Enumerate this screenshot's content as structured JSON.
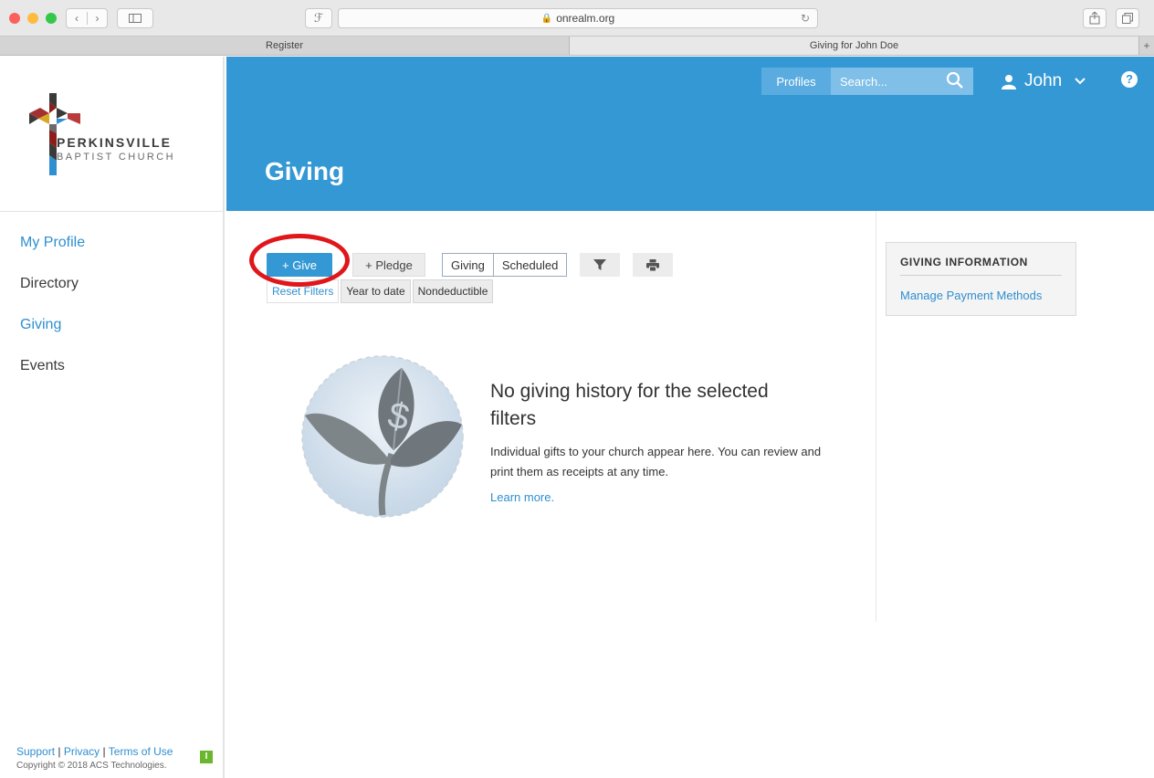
{
  "browser": {
    "url": "onrealm.org",
    "tabs": [
      {
        "label": "Register",
        "active": false
      },
      {
        "label": "Giving for John Doe",
        "active": true
      }
    ],
    "new_tab": "+"
  },
  "org": {
    "name_line1": "PERKINSVILLE",
    "name_line2": "BAPTIST CHURCH"
  },
  "sidebar": {
    "items": [
      {
        "label": "My Profile",
        "style": "link"
      },
      {
        "label": "Directory",
        "style": "plain"
      },
      {
        "label": "Giving",
        "style": "link"
      },
      {
        "label": "Events",
        "style": "plain"
      }
    ],
    "footer": {
      "support": "Support",
      "privacy": "Privacy",
      "terms": "Terms of Use",
      "separator": "|",
      "copyright": "Copyright © 2018 ACS Technologies.",
      "badge": "I"
    }
  },
  "header": {
    "profiles_label": "Profiles",
    "search_placeholder": "Search...",
    "user_name": "John",
    "help": "?",
    "page_title": "Giving"
  },
  "toolbar": {
    "give_label": "+ Give",
    "pledge_label": "+ Pledge",
    "view_tabs": [
      "Giving",
      "Scheduled"
    ],
    "filter_chips": [
      "Reset Filters",
      "Year to date",
      "Nondeductible"
    ]
  },
  "empty_state": {
    "title": "No giving history for the selected filters",
    "description": "Individual gifts to your church appear here. You can review and print them as receipts at any time.",
    "link": "Learn more."
  },
  "info_panel": {
    "title": "GIVING INFORMATION",
    "link": "Manage Payment Methods"
  },
  "colors": {
    "primary": "#3498d4",
    "link": "#2f8fd0",
    "highlight": "#e0161b"
  }
}
